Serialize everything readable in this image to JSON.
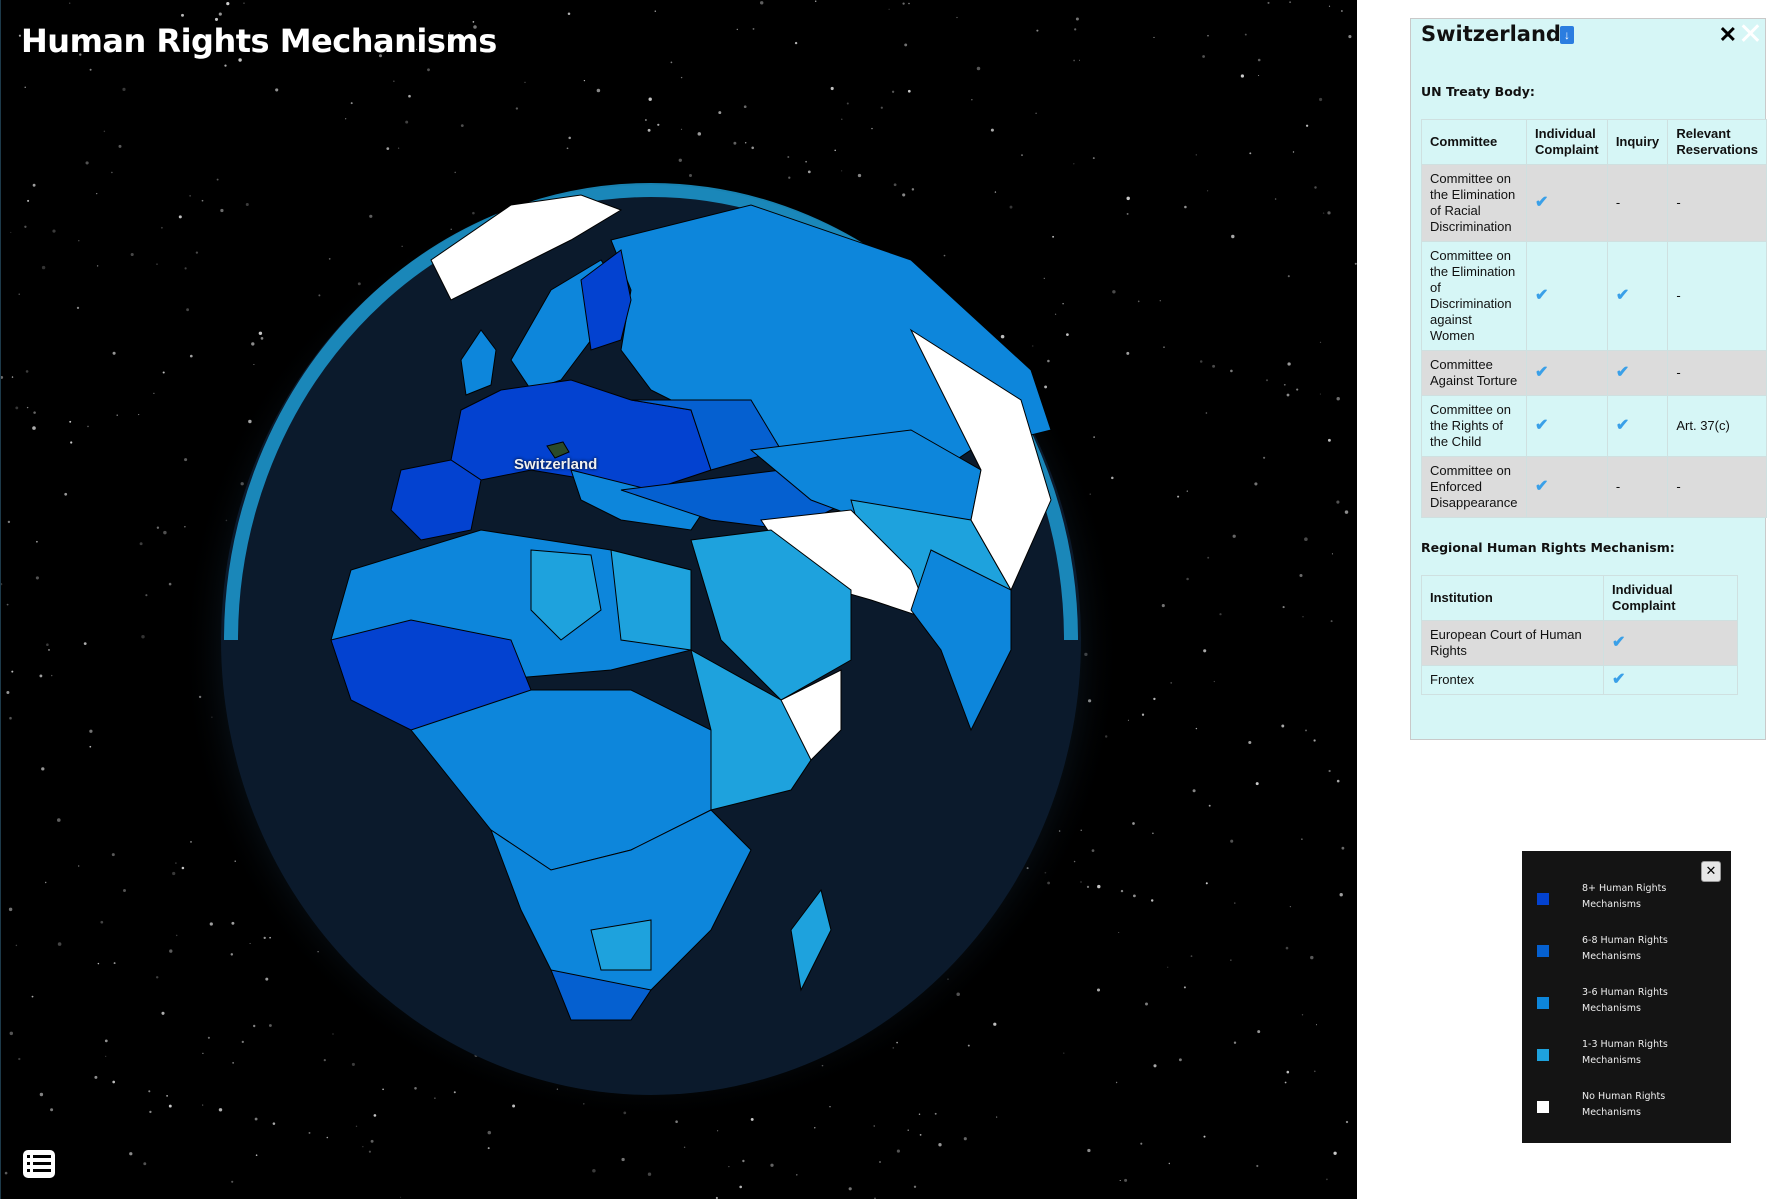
{
  "app": {
    "title": "Human Rights Mechanisms"
  },
  "map": {
    "selected_label": "Switzerland",
    "list_icon": "list-icon"
  },
  "panel": {
    "country": "Switzerland",
    "download_icon": "file-download-icon",
    "close_symbol": "✕",
    "un_section_title": "UN Treaty Body:",
    "un_table": {
      "headers": [
        "Committee",
        "Individual Complaint",
        "Inquiry",
        "Relevant Reservations"
      ],
      "rows": [
        {
          "committee": "Committee on the Elimination of Racial Discrimination",
          "individual_complaint": "✔",
          "inquiry": "-",
          "reservations": "-"
        },
        {
          "committee": "Committee on the Elimination of Discrimination against Women",
          "individual_complaint": "✔",
          "inquiry": "✔",
          "reservations": "-"
        },
        {
          "committee": "Committee Against Torture",
          "individual_complaint": "✔",
          "inquiry": "✔",
          "reservations": "-"
        },
        {
          "committee": "Committee on the Rights of the Child",
          "individual_complaint": "✔",
          "inquiry": "✔",
          "reservations": "Art. 37(c)"
        },
        {
          "committee": "Committee on Enforced Disappearance",
          "individual_complaint": "✔",
          "inquiry": "-",
          "reservations": "-"
        }
      ]
    },
    "regional_section_title": "Regional Human Rights Mechanism:",
    "regional_table": {
      "headers": [
        "Institution",
        "Individual Complaint"
      ],
      "rows": [
        {
          "institution": "European Court of Human Rights",
          "individual_complaint": "✔"
        },
        {
          "institution": "Frontex",
          "individual_complaint": "✔"
        }
      ]
    }
  },
  "legend": {
    "close_symbol": "✕",
    "items": [
      {
        "label_line1": "8+ Human Rights",
        "label_line2": "Mechanisms",
        "color": "#0342d0"
      },
      {
        "label_line1": "6-8 Human Rights",
        "label_line2": "Mechanisms",
        "color": "#0560d0"
      },
      {
        "label_line1": "3-6 Human Rights",
        "label_line2": "Mechanisms",
        "color": "#0d86db"
      },
      {
        "label_line1": "1-3 Human Rights",
        "label_line2": "Mechanisms",
        "color": "#1ea2dd"
      },
      {
        "label_line1": "No Human Rights",
        "label_line2": "Mechanisms",
        "color": "#ffffff"
      }
    ]
  }
}
